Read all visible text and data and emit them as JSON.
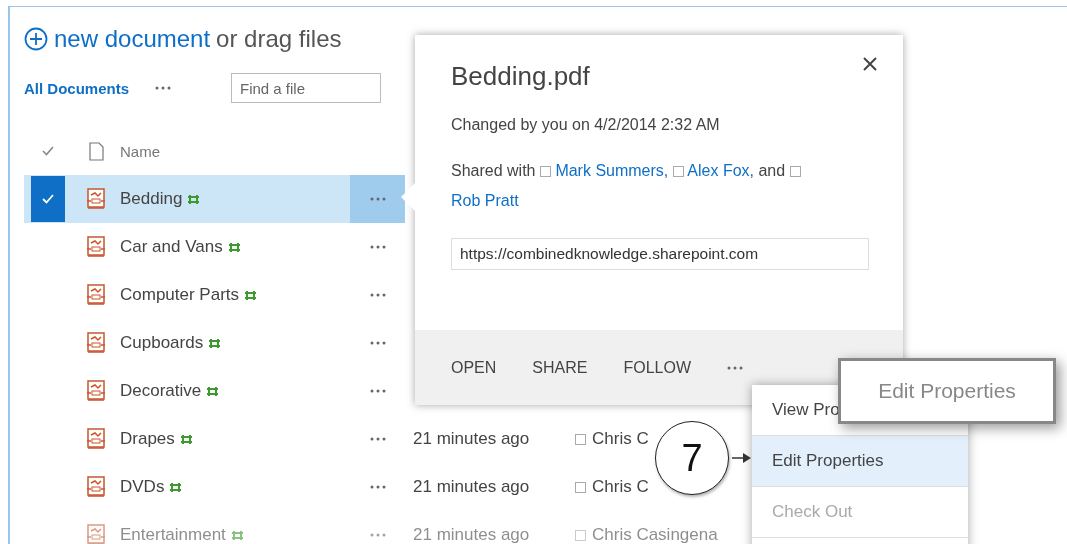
{
  "heading": {
    "link": "new document",
    "rest": "or drag files"
  },
  "view_bar": {
    "current_view": "All Documents",
    "search": {
      "placeholder": "Find a file"
    }
  },
  "table": {
    "columns": [
      {
        "label": "Name"
      }
    ],
    "rows": [
      {
        "name": "Bedding",
        "selected": true,
        "new": true,
        "faded": false
      },
      {
        "name": "Car and Vans",
        "selected": false,
        "new": true,
        "faded": false
      },
      {
        "name": "Computer Parts",
        "selected": false,
        "new": true,
        "faded": false
      },
      {
        "name": "Cupboards",
        "selected": false,
        "new": true,
        "faded": false
      },
      {
        "name": "Decorative",
        "selected": false,
        "new": true,
        "faded": false
      },
      {
        "name": "Drapes",
        "selected": false,
        "new": true,
        "faded": false,
        "modified": "21 minutes ago",
        "modified_by": "Chris C"
      },
      {
        "name": "DVDs",
        "selected": false,
        "new": true,
        "faded": false,
        "modified": "21 minutes ago",
        "modified_by": "Chris C"
      },
      {
        "name": "Entertainment",
        "selected": false,
        "new": true,
        "faded": true,
        "modified": "21 minutes ago",
        "modified_by": "Chris Casingena"
      }
    ]
  },
  "callout": {
    "title": "Bedding.pdf",
    "changed": "Changed by you on 4/2/2014 2:32 AM",
    "shared_with": [
      {
        "before": "Shared with",
        "name": "Mark Summers,"
      },
      {
        "name": "Alex Fox,"
      },
      {
        "before": "and",
        "name": "Rob Pratt"
      }
    ],
    "link": "https://combinedknowledge.sharepoint.com",
    "actions": [
      "OPEN",
      "SHARE",
      "FOLLOW"
    ]
  },
  "menu": {
    "items": [
      {
        "label": "View Pro",
        "selected": false,
        "disabled": false
      },
      {
        "label": "Edit Properties",
        "selected": true,
        "disabled": false
      },
      {
        "label": "Check Out",
        "selected": false,
        "disabled": true
      }
    ]
  },
  "tooltip": "Edit Properties",
  "step_marker": "7"
}
